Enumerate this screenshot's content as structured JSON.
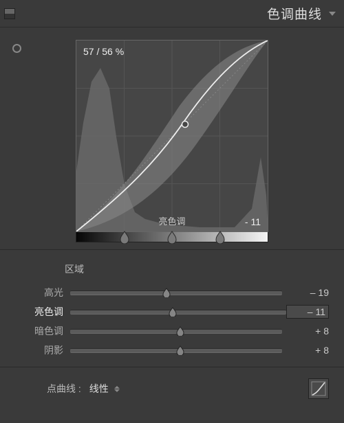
{
  "header": {
    "title": "色调曲线"
  },
  "curve": {
    "coords": "57 / 56 %",
    "region_label": "亮色调",
    "region_value": "- 11",
    "strip_handles": [
      25,
      50,
      75
    ]
  },
  "sliders": {
    "title": "区域",
    "rows": [
      {
        "label": "高光",
        "value": "– 19",
        "pos": 45.3
      },
      {
        "label": "亮色调",
        "value": "– 11",
        "pos": 47.3,
        "active": true
      },
      {
        "label": "暗色调",
        "value": "+ 8",
        "pos": 52.0
      },
      {
        "label": "阴影",
        "value": "+ 8",
        "pos": 52.0
      }
    ]
  },
  "footer": {
    "label": "点曲线 :",
    "select": "线性"
  }
}
